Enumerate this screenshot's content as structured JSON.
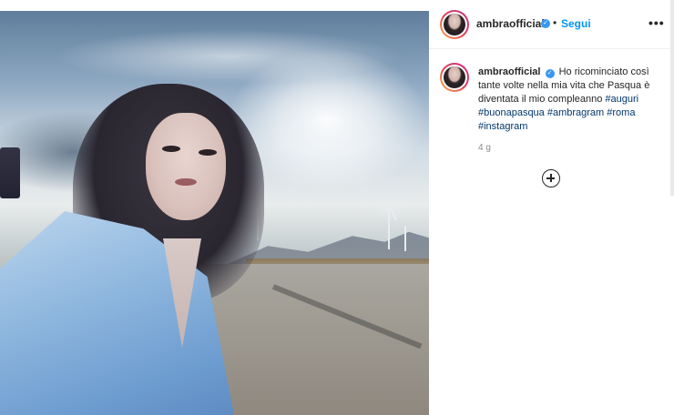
{
  "post": {
    "photo_alt_icon": "photo-image",
    "author": {
      "username": "ambraofficial",
      "verified_icon": "verified-badge-icon",
      "separator": "•",
      "follow_label": "Segui",
      "more_label": "•••"
    },
    "caption": {
      "username": "ambraofficial",
      "text": "Ho ricominciato così tante volte nella mia vita che Pasqua è diventata il mio compleanno",
      "hashtags": [
        "#auguri",
        "#buonapasqua",
        "#ambragram",
        "#roma",
        "#instagram"
      ]
    },
    "age": "4 g",
    "add_comment_icon": "plus-circle-icon"
  },
  "colors": {
    "accent": "#0095f6",
    "verified": "#3897f0",
    "hashtag": "#00376b",
    "muted": "#8e8e8e"
  }
}
